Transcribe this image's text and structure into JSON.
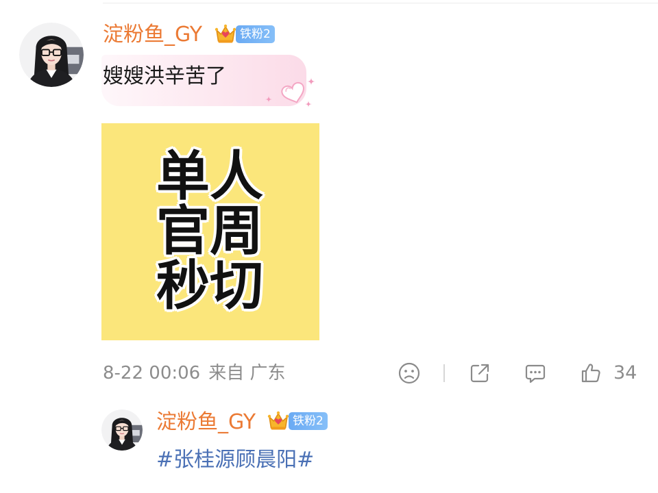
{
  "theme": {
    "username_color": "#eb7a34",
    "badge_color": "#6aaaf3",
    "hashtag_color": "#4a70b5",
    "meta_color": "#8c8c8c",
    "image_background": "#fbe67b"
  },
  "comment": {
    "author": {
      "name": "淀粉鱼_GY",
      "crown_icon": "crown-icon",
      "fan_badge": "铁粉2"
    },
    "text": "嫂嫂洪辛苦了",
    "bubble_decoration_icon": "heart-sparkle-icon",
    "image": {
      "lines": [
        "单人",
        "官周",
        "秒切"
      ]
    },
    "meta": {
      "time": "8-22 00:06",
      "source": "来自 广东"
    },
    "actions": {
      "reaction_icon": "frown-face-icon",
      "share_icon": "share-icon",
      "comment_icon": "comment-icon",
      "like_icon": "thumbs-up-icon",
      "like_count": "34"
    }
  },
  "reply": {
    "author": {
      "name": "淀粉鱼_GY",
      "crown_icon": "crown-icon",
      "fan_badge": "铁粉2"
    },
    "text": "#张桂源顾晨阳#"
  }
}
